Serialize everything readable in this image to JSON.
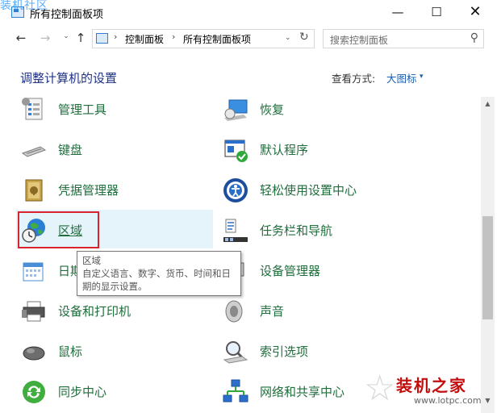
{
  "window": {
    "title": "所有控制面板项",
    "watermark": "装机社区",
    "min_icon": "—",
    "max_icon": "☐",
    "close_icon": "✕"
  },
  "nav": {
    "back": "←",
    "forward": "→",
    "recent": "⌄",
    "up": "↑",
    "breadcrumb": [
      "控制面板",
      "所有控制面板项"
    ],
    "separator": "›",
    "dropdown": "⌄",
    "refresh": "↻"
  },
  "search": {
    "placeholder": "搜索控制面板",
    "icon": "⚲"
  },
  "header": {
    "title": "调整计算机的设置",
    "view_label": "查看方式:",
    "view_value": "大图标",
    "view_caret": "▾"
  },
  "items_left": [
    {
      "label": "管理工具",
      "icon": "admin-tools-icon"
    },
    {
      "label": "键盘",
      "icon": "keyboard-icon"
    },
    {
      "label": "凭据管理器",
      "icon": "credential-manager-icon"
    },
    {
      "label": "区域",
      "icon": "region-globe-clock-icon"
    },
    {
      "label": "日期和时间",
      "icon": "calendar-icon"
    },
    {
      "label": "设备和打印机",
      "icon": "printer-icon"
    },
    {
      "label": "鼠标",
      "icon": "mouse-icon"
    },
    {
      "label": "同步中心",
      "icon": "sync-center-icon"
    }
  ],
  "items_right": [
    {
      "label": "恢复",
      "icon": "recovery-icon"
    },
    {
      "label": "默认程序",
      "icon": "default-programs-icon"
    },
    {
      "label": "轻松使用设置中心",
      "icon": "ease-of-access-icon"
    },
    {
      "label": "任务栏和导航",
      "icon": "taskbar-icon"
    },
    {
      "label": "设备管理器",
      "icon": "device-manager-icon"
    },
    {
      "label": "声音",
      "icon": "speaker-icon"
    },
    {
      "label": "索引选项",
      "icon": "indexing-icon"
    },
    {
      "label": "网络和共享中心",
      "icon": "network-icon"
    }
  ],
  "tooltip": {
    "title": "区域",
    "description": "自定义语言、数字、货币、时间和日期的显示设置。"
  },
  "scrollbar": {
    "up": "▲",
    "down": "▼"
  },
  "brand": {
    "name": "装机之家",
    "url": "www.lotpc.com",
    "star": "☆"
  },
  "colors": {
    "link_green": "#1f6e3c",
    "heading_blue": "#1e3287",
    "highlight_bg": "#e5f3fb",
    "annotation_red": "#d9232e"
  }
}
